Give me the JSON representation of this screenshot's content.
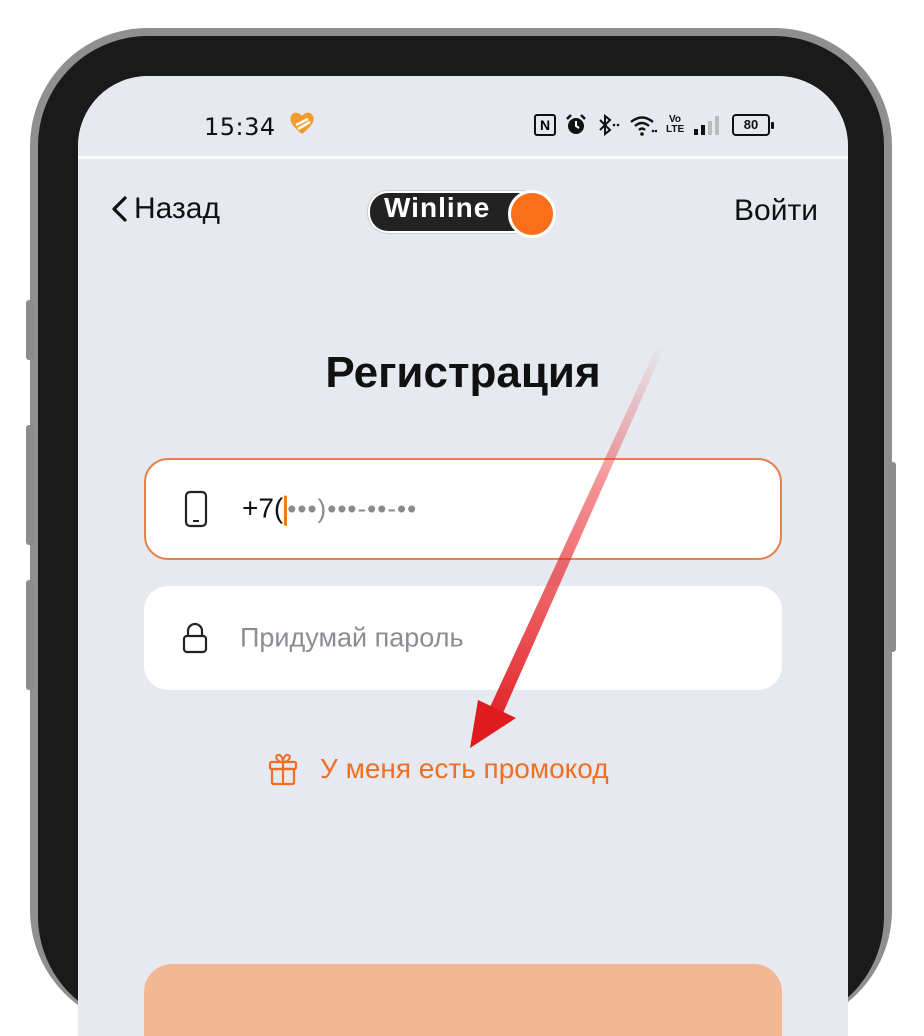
{
  "status_bar": {
    "time": "15:34",
    "nfc": "N",
    "volte": "Vo LTE",
    "battery": "80"
  },
  "nav": {
    "back_label": "Назад",
    "logo_text": "Winline",
    "login_label": "Войти"
  },
  "form": {
    "title": "Регистрация",
    "phone_prefix": "+7(",
    "phone_mask": "•••)•••-••-••",
    "password_placeholder": "Придумай пароль",
    "promo_label": "У меня есть промокод"
  },
  "colors": {
    "accent": "#ef6f24",
    "logo_dot": "#fb6f1b",
    "screen_bg": "#e6e9ef",
    "cta_bg": "#f2b894",
    "annotation_arrow": "#e8252a"
  },
  "icons": [
    "heart-icon",
    "nfc-icon",
    "alarm-icon",
    "bluetooth-icon",
    "wifi-icon",
    "signal-icon",
    "battery-icon",
    "chevron-left-icon",
    "smartphone-icon",
    "lock-icon",
    "gift-icon"
  ]
}
